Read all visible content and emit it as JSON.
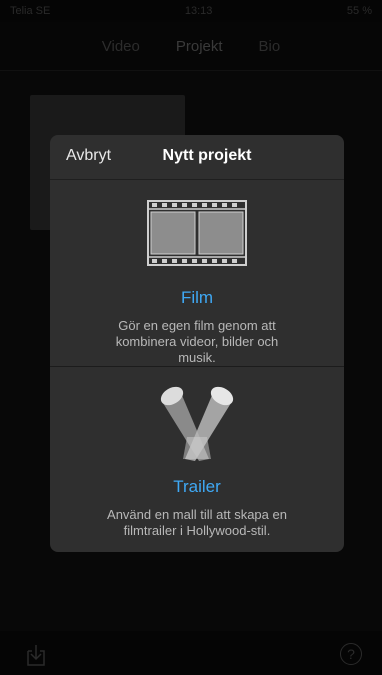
{
  "status_bar": {
    "carrier": "Telia SE",
    "time": "13:13",
    "battery": "55 %"
  },
  "top_tabs": [
    "Video",
    "Projekt",
    "Bio"
  ],
  "modal": {
    "cancel_label": "Avbryt",
    "title": "Nytt projekt",
    "options": [
      {
        "label": "Film",
        "description": "Gör en egen film genom att kombinera videor, bilder och musik."
      },
      {
        "label": "Trailer",
        "description": "Använd en mall till att skapa en filmtrailer i Hollywood-stil."
      }
    ]
  },
  "bottom_bar": {
    "help_symbol": "?"
  },
  "colors": {
    "accent": "#3fa9f5",
    "modal_bg": "#2f2f2f"
  }
}
